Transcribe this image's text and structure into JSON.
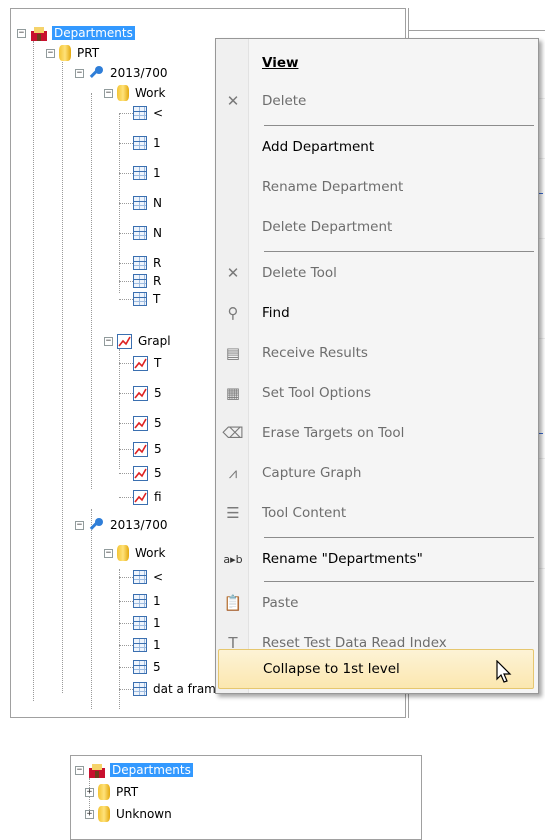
{
  "top_tree": {
    "root_label": "Departments",
    "nodes": [
      {
        "label": "PRT"
      },
      {
        "label": "2013/700"
      },
      {
        "label": "Work"
      },
      {
        "label": "<"
      },
      {
        "label": "1"
      },
      {
        "label": "1"
      },
      {
        "label": "N"
      },
      {
        "label": "N"
      },
      {
        "label": "R"
      },
      {
        "label": "R"
      },
      {
        "label": "T"
      },
      {
        "label": "Grapl"
      },
      {
        "label": "T"
      },
      {
        "label": "5"
      },
      {
        "label": "5"
      },
      {
        "label": "5"
      },
      {
        "label": "5"
      },
      {
        "label": "fi"
      },
      {
        "label": "2013/700"
      },
      {
        "label": "Work"
      },
      {
        "label": "<"
      },
      {
        "label": "1"
      },
      {
        "label": "1"
      },
      {
        "label": "1"
      },
      {
        "label": "5"
      },
      {
        "label": "dat a frame error"
      }
    ]
  },
  "context_menu": {
    "items": [
      {
        "label": "View",
        "icon": "none",
        "bold": true
      },
      {
        "label": "Delete",
        "icon": "delete-x-icon",
        "disabled": true
      },
      {
        "label": "Add Department",
        "icon": "none"
      },
      {
        "label": "Rename Department",
        "icon": "none",
        "disabled": true
      },
      {
        "label": "Delete Department",
        "icon": "none",
        "disabled": true
      },
      {
        "label": "Delete Tool",
        "icon": "delete-tool-icon",
        "disabled": true
      },
      {
        "label": "Find",
        "icon": "search-icon"
      },
      {
        "label": "Receive Results",
        "icon": "receive-results-icon",
        "disabled": true
      },
      {
        "label": "Set Tool Options",
        "icon": "tool-options-icon",
        "disabled": true
      },
      {
        "label": "Erase Targets on Tool",
        "icon": "eraser-icon",
        "disabled": true
      },
      {
        "label": "Capture Graph",
        "icon": "capture-graph-icon",
        "disabled": true
      },
      {
        "label": "Tool Content",
        "icon": "tool-content-icon",
        "disabled": true
      },
      {
        "label": "Rename \"Departments\"",
        "icon": "rename-icon"
      },
      {
        "label": "Paste",
        "icon": "paste-icon",
        "disabled": true
      },
      {
        "label": "Reset Test Data Read Index",
        "icon": "reset-index-icon",
        "disabled": true
      },
      {
        "label": "Collapse to 1st level",
        "icon": "none",
        "highlighted": true
      }
    ]
  },
  "bottom_tree": {
    "root_label": "Departments",
    "nodes": [
      {
        "label": "PRT"
      },
      {
        "label": "Unknown"
      }
    ]
  },
  "colors": {
    "selection": "#3399ff",
    "menu_highlight": "#fbe7b0",
    "table_icon": "#3a6fb0",
    "database_icon": "#f4c433"
  }
}
